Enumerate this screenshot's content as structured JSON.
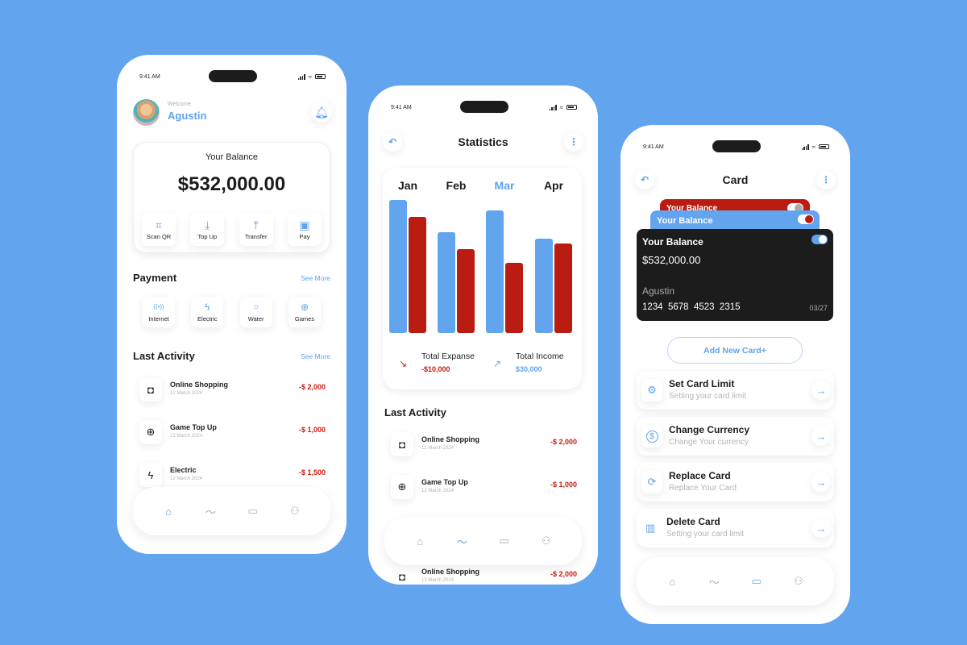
{
  "colors": {
    "accent": "#5fa3ee",
    "expense": "#c71c12",
    "background": "#63a4ef",
    "card_dark": "#1c1c1c"
  },
  "status_bar": {
    "time": "9:41 AM"
  },
  "home": {
    "welcome": "Welcome",
    "username": "Agustin",
    "balance_label": "Your Balance",
    "balance_value": "$532,000.00",
    "actions": [
      {
        "label": "Scan QR",
        "icon": "qr-scan-icon",
        "glyph": "⌗"
      },
      {
        "label": "Top Up",
        "icon": "download-tray-icon",
        "glyph": "⤓"
      },
      {
        "label": "Transfer",
        "icon": "upload-tray-icon",
        "glyph": "⤒"
      },
      {
        "label": "Pay",
        "icon": "wallet-icon",
        "glyph": "▣"
      }
    ],
    "payment_title": "Payment",
    "see_more": "See More",
    "payments": [
      {
        "label": "Internet",
        "icon": "antenna-icon",
        "glyph": "((•))"
      },
      {
        "label": "Electric",
        "icon": "lightning-icon",
        "glyph": "ϟ"
      },
      {
        "label": "Water",
        "icon": "water-drop-icon",
        "glyph": "💧"
      },
      {
        "label": "Games",
        "icon": "gamepad-icon",
        "glyph": "🎮"
      }
    ],
    "activity_title": "Last Activity",
    "activities": [
      {
        "title": "Online Shopping",
        "date": "12 March 2024",
        "amount": "-$ 2,000",
        "icon": "shopping-bag-icon",
        "glyph": "👜"
      },
      {
        "title": "Game Top Up",
        "date": "12 March 2024",
        "amount": "-$ 1,000",
        "icon": "gamepad-icon",
        "glyph": "🎮"
      },
      {
        "title": "Electric",
        "date": "12 March 2024",
        "amount": "-$ 1,500",
        "icon": "lightning-icon",
        "glyph": "ϟ"
      }
    ]
  },
  "stats": {
    "title": "Statistics",
    "active_month": "Mar",
    "total_expense_label": "Total Expanse",
    "total_expense_value": "-$10,000",
    "total_income_label": "Total Income",
    "total_income_value": "$30,000",
    "activity_title": "Last Activity",
    "activities": [
      {
        "title": "Online Shopping",
        "date": "12 March 2024",
        "amount": "-$ 2,000",
        "icon": "shopping-bag-icon",
        "glyph": "👜"
      },
      {
        "title": "Game Top Up",
        "date": "12 March 2024",
        "amount": "-$ 1,000",
        "icon": "gamepad-icon",
        "glyph": "🎮"
      },
      {
        "title": "Online Shopping",
        "date": "12 March 2024",
        "amount": "-$ 2,000",
        "icon": "shopping-bag-icon",
        "glyph": "👜"
      }
    ]
  },
  "chart_data": {
    "type": "bar",
    "title": "",
    "xlabel": "",
    "ylabel": "",
    "categories": [
      "Jan",
      "Feb",
      "Mar",
      "Apr"
    ],
    "series": [
      {
        "name": "Income",
        "color": "#63a4ef",
        "values": [
          100,
          76,
          92,
          71
        ]
      },
      {
        "name": "Expense",
        "color": "#bb1c11",
        "values": [
          87,
          63,
          53,
          67
        ]
      }
    ],
    "ylim": [
      0,
      100
    ],
    "grid": false,
    "legend": "none"
  },
  "card": {
    "title": "Card",
    "back_cards": [
      {
        "title": "Your Balance",
        "color": "#bb1c11"
      },
      {
        "title": "Your Balance",
        "color": "#63a4ef"
      }
    ],
    "main_card": {
      "title": "Your Balance",
      "balance": "$532,000.00",
      "holder": "Agustin",
      "number": "1234  5678  4523  2315",
      "expiry": "03/27"
    },
    "add_button": "Add New Card+",
    "menu": [
      {
        "title": "Set Card Limit",
        "subtitle": "Setting your card limit",
        "icon": "gear-icon",
        "glyph": "⚙"
      },
      {
        "title": "Change Currency",
        "subtitle": "Change Your currency",
        "icon": "dollar-circle-icon",
        "glyph": "$"
      },
      {
        "title": "Replace Card",
        "subtitle": "Replace Your Card",
        "icon": "refresh-icon",
        "glyph": "⟳"
      },
      {
        "title": "Delete Card",
        "subtitle": "Setting your card limit",
        "icon": "trash-icon",
        "glyph": "🗑"
      }
    ]
  },
  "nav": [
    {
      "name": "home",
      "icon": "home-icon",
      "glyph": "⌂"
    },
    {
      "name": "statistics",
      "icon": "trend-icon",
      "glyph": "〜"
    },
    {
      "name": "card",
      "icon": "card-icon",
      "glyph": "▭"
    },
    {
      "name": "profile",
      "icon": "user-icon",
      "glyph": "👤"
    }
  ]
}
